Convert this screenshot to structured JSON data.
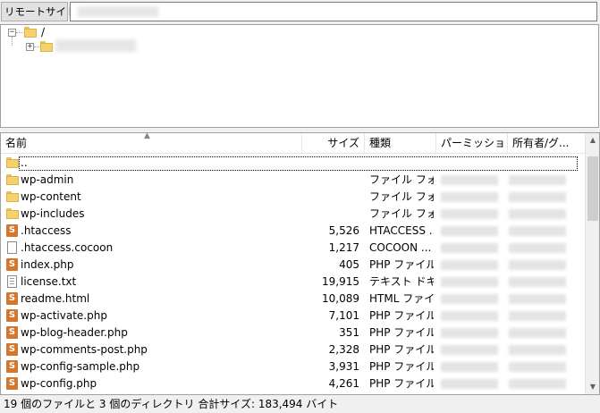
{
  "site_bar": {
    "label": "リモートサイト:",
    "value": ""
  },
  "tree": {
    "root_label": "/",
    "root_expander": "−",
    "child_expander": "+"
  },
  "header": {
    "col_name": "名前",
    "col_size": "サイズ",
    "col_type": "種類",
    "col_perm": "パーミッション",
    "col_owner": "所有者/グ..."
  },
  "files": [
    {
      "name": "..",
      "size": "",
      "type": "",
      "icon": "folder"
    },
    {
      "name": "wp-admin",
      "size": "",
      "type": "ファイル フォ...",
      "icon": "folder"
    },
    {
      "name": "wp-content",
      "size": "",
      "type": "ファイル フォ...",
      "icon": "folder"
    },
    {
      "name": "wp-includes",
      "size": "",
      "type": "ファイル フォ...",
      "icon": "folder"
    },
    {
      "name": ".htaccess",
      "size": "5,526",
      "type": "HTACCESS ...",
      "icon": "php"
    },
    {
      "name": ".htaccess.cocoon",
      "size": "1,217",
      "type": "COCOON ...",
      "icon": "doc"
    },
    {
      "name": "index.php",
      "size": "405",
      "type": "PHP ファイル",
      "icon": "php"
    },
    {
      "name": "license.txt",
      "size": "19,915",
      "type": "テキスト ドキ...",
      "icon": "txt"
    },
    {
      "name": "readme.html",
      "size": "10,089",
      "type": "HTML ファイ...",
      "icon": "html"
    },
    {
      "name": "wp-activate.php",
      "size": "7,101",
      "type": "PHP ファイル",
      "icon": "php"
    },
    {
      "name": "wp-blog-header.php",
      "size": "351",
      "type": "PHP ファイル",
      "icon": "php"
    },
    {
      "name": "wp-comments-post.php",
      "size": "2,328",
      "type": "PHP ファイル",
      "icon": "php"
    },
    {
      "name": "wp-config-sample.php",
      "size": "3,931",
      "type": "PHP ファイル",
      "icon": "php"
    },
    {
      "name": "wp-config.php",
      "size": "4,261",
      "type": "PHP ファイル",
      "icon": "php"
    }
  ],
  "status": {
    "text": "19 個のファイルと 3 個のディレクトリ 合計サイズ: 183,494 バイト"
  }
}
